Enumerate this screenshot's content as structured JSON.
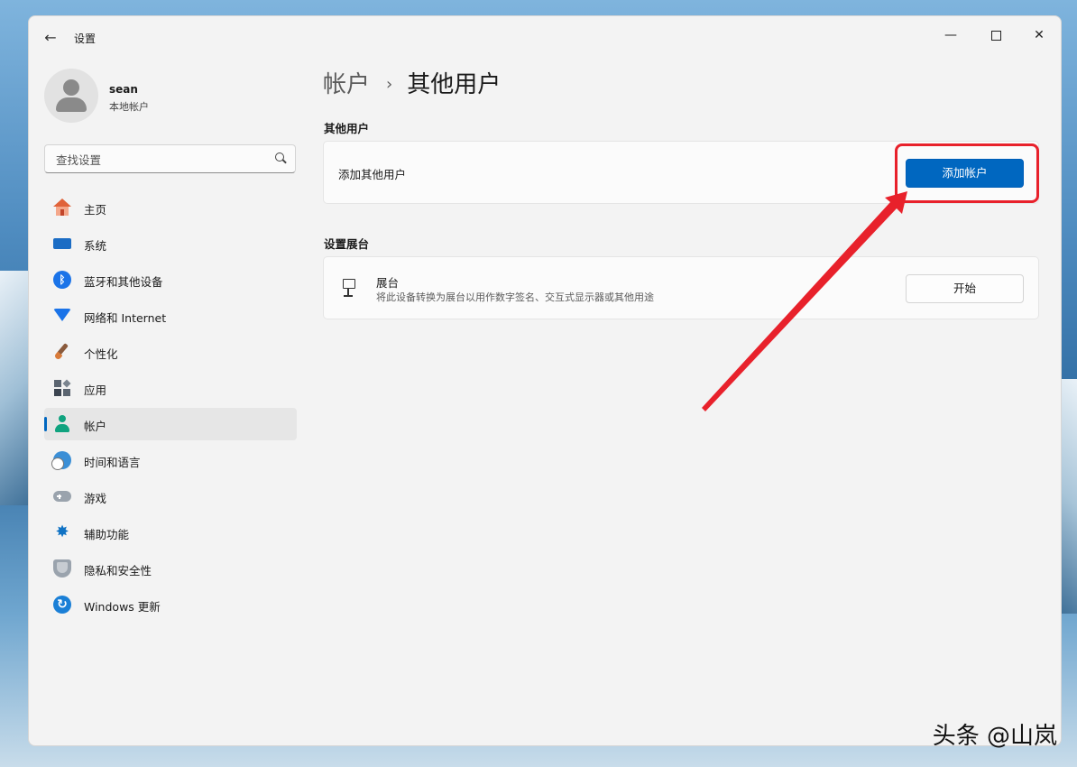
{
  "window": {
    "title": "设置"
  },
  "user": {
    "name": "sean",
    "account_type": "本地帐户"
  },
  "search": {
    "placeholder": "查找设置"
  },
  "sidebar": {
    "items": [
      {
        "label": "主页"
      },
      {
        "label": "系统"
      },
      {
        "label": "蓝牙和其他设备"
      },
      {
        "label": "网络和 Internet"
      },
      {
        "label": "个性化"
      },
      {
        "label": "应用"
      },
      {
        "label": "帐户"
      },
      {
        "label": "时间和语言"
      },
      {
        "label": "游戏"
      },
      {
        "label": "辅助功能"
      },
      {
        "label": "隐私和安全性"
      },
      {
        "label": "Windows 更新"
      }
    ],
    "active_index": 6
  },
  "breadcrumb": {
    "parent": "帐户",
    "separator": "›",
    "current": "其他用户"
  },
  "other_users": {
    "section_title": "其他用户",
    "row_label": "添加其他用户",
    "button_label": "添加帐户"
  },
  "kiosk": {
    "section_title": "设置展台",
    "title": "展台",
    "description": "将此设备转换为展台以用作数字签名、交互式显示器或其他用途",
    "button_label": "开始"
  },
  "annotation": {
    "highlight_color": "#e8212b",
    "arrow_color": "#e8212b"
  },
  "watermark": {
    "text": "头条 @山岚"
  },
  "colors": {
    "accent": "#0067c0",
    "window_bg": "#f3f3f3"
  }
}
